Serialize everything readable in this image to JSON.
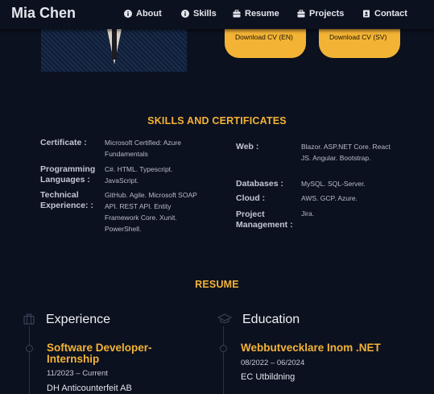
{
  "header": {
    "brand": "Mia Chen",
    "nav": [
      {
        "label": "About",
        "icon": "info-circle-icon"
      },
      {
        "label": "Skills",
        "icon": "info-circle-icon"
      },
      {
        "label": "Resume",
        "icon": "briefcase-icon"
      },
      {
        "label": "Projects",
        "icon": "briefcase-icon"
      },
      {
        "label": "Contact",
        "icon": "contact-card-icon"
      }
    ]
  },
  "hero": {
    "download_en": "Download CV (EN)",
    "download_sv": "Download CV (SV)"
  },
  "skills": {
    "title": "SKILLS AND CERTIFICATES",
    "left": [
      {
        "label": "Certificate :",
        "value": "Microsoft Certified: Azure Fundamentals"
      },
      {
        "label": "Programming Languages :",
        "value": "C#. HTML. Typescript. JavaScript."
      },
      {
        "label": "Technical Experience: :",
        "value": "GitHub. Agile. Microsoft SOAP API. REST API. Entity Framework Core. Xunit. PowerShell."
      }
    ],
    "right": [
      {
        "label": "Web :",
        "value": "Blazor. ASP.NET Core. React JS. Angular. Bootstrap."
      },
      {
        "label": "Databases :",
        "value": "MySQL. SQL-Server."
      },
      {
        "label": "Cloud :",
        "value": "AWS. GCP. Azure."
      },
      {
        "label": "Project Management :",
        "value": "Jira."
      }
    ]
  },
  "resume": {
    "title": "RESUME",
    "experience": {
      "heading": "Experience",
      "items": [
        {
          "title": "Software Developer- Internship",
          "date": "11/2023 – Current",
          "place": "DH Anticounterfeit AB"
        }
      ]
    },
    "education": {
      "heading": "Education",
      "items": [
        {
          "title": "Webbutvecklare Inom .NET",
          "date": "08/2022 – 06/2024",
          "place": "EC Utbildning"
        }
      ]
    }
  },
  "colors": {
    "background": "#0c1120",
    "accent": "#f3b335",
    "text": "#cfd3dc"
  }
}
